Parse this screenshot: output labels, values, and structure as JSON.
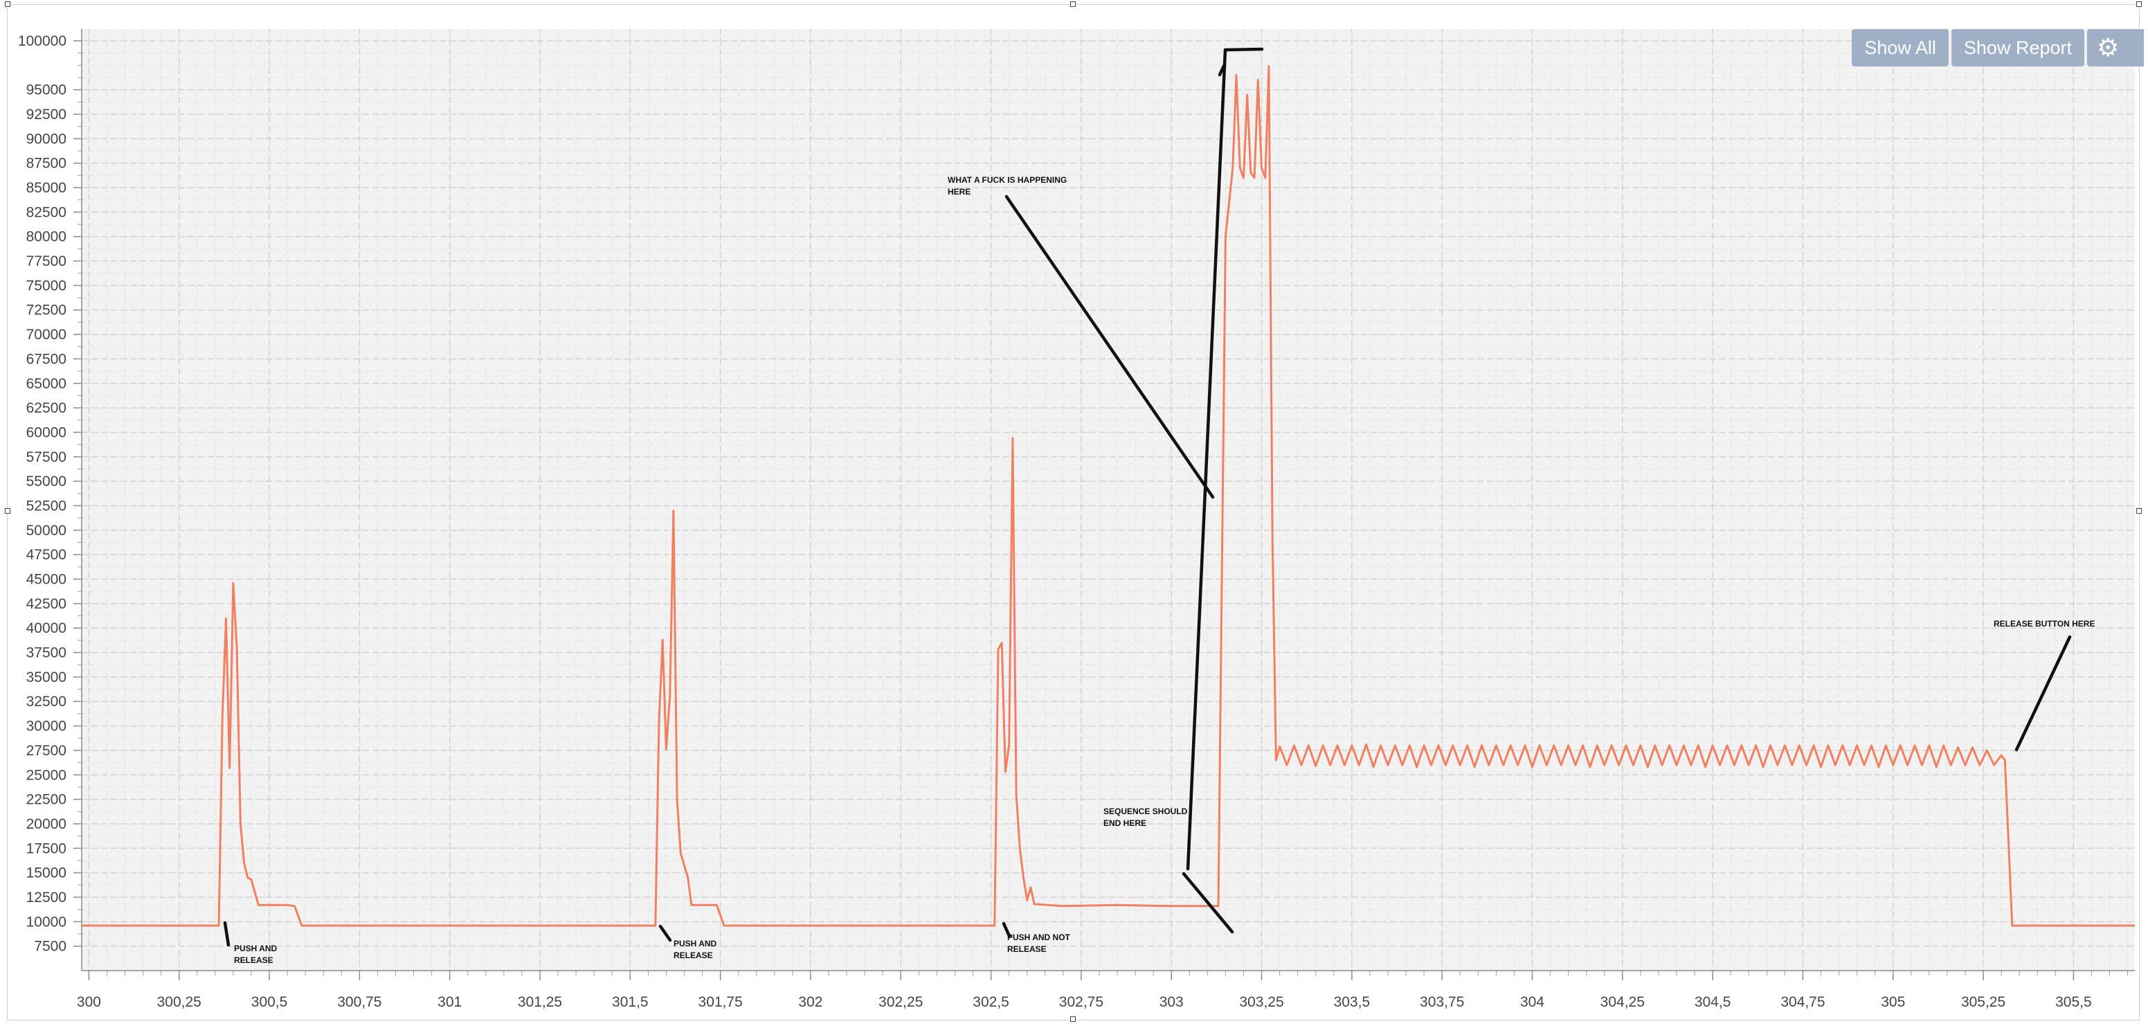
{
  "toolbar": {
    "show_all_label": "Show All",
    "show_report_label": "Show Report",
    "settings_icon": "gear-icon"
  },
  "chart_data": {
    "type": "line",
    "title": "",
    "xlabel": "",
    "ylabel": "",
    "xlim": [
      299.98,
      305.67
    ],
    "ylim": [
      5000,
      101200
    ],
    "grid": true,
    "line_color": "#f08060",
    "x_ticks": [
      "300",
      "300,25",
      "300,5",
      "300,75",
      "301",
      "301,25",
      "301,5",
      "301,75",
      "302",
      "302,25",
      "302,5",
      "302,75",
      "303",
      "303,25",
      "303,5",
      "303,75",
      "304",
      "304,25",
      "304,5",
      "304,75",
      "305",
      "305,25",
      "305,5"
    ],
    "y_ticks": [
      "100000",
      "95000",
      "92500",
      "90000",
      "87500",
      "85000",
      "82500",
      "80000",
      "77500",
      "75000",
      "72500",
      "70000",
      "67500",
      "65000",
      "62500",
      "60000",
      "57500",
      "55000",
      "52500",
      "50000",
      "47500",
      "45000",
      "42500",
      "40000",
      "37500",
      "35000",
      "32500",
      "30000",
      "27500",
      "25000",
      "22500",
      "20000",
      "17500",
      "15000",
      "12500",
      "10000",
      "7500"
    ],
    "series": [
      {
        "points": [
          [
            299.98,
            9600
          ],
          [
            300.36,
            9600
          ],
          [
            300.37,
            31000
          ],
          [
            300.38,
            41000
          ],
          [
            300.39,
            25700
          ],
          [
            300.4,
            44600
          ],
          [
            300.41,
            38000
          ],
          [
            300.42,
            20000
          ],
          [
            300.43,
            16000
          ],
          [
            300.44,
            14500
          ],
          [
            300.45,
            14300
          ],
          [
            300.47,
            11700
          ],
          [
            300.55,
            11700
          ],
          [
            300.57,
            11600
          ],
          [
            300.59,
            9600
          ],
          [
            301.57,
            9600
          ],
          [
            301.58,
            30500
          ],
          [
            301.59,
            38800
          ],
          [
            301.6,
            27600
          ],
          [
            301.61,
            33000
          ],
          [
            301.62,
            52000
          ],
          [
            301.63,
            22500
          ],
          [
            301.64,
            17000
          ],
          [
            301.66,
            14500
          ],
          [
            301.67,
            11700
          ],
          [
            301.74,
            11700
          ],
          [
            301.76,
            9600
          ],
          [
            302.51,
            9600
          ],
          [
            302.52,
            37800
          ],
          [
            302.53,
            38500
          ],
          [
            302.54,
            25300
          ],
          [
            302.55,
            28000
          ],
          [
            302.56,
            59400
          ],
          [
            302.57,
            23000
          ],
          [
            302.58,
            17500
          ],
          [
            302.59,
            14500
          ],
          [
            302.6,
            12200
          ],
          [
            302.61,
            13500
          ],
          [
            302.62,
            11800
          ],
          [
            302.7,
            11600
          ],
          [
            302.85,
            11700
          ],
          [
            303.0,
            11600
          ],
          [
            303.13,
            11600
          ],
          [
            303.15,
            80000
          ],
          [
            303.17,
            87000
          ],
          [
            303.18,
            96500
          ],
          [
            303.19,
            87000
          ],
          [
            303.2,
            86000
          ],
          [
            303.21,
            94500
          ],
          [
            303.22,
            86500
          ],
          [
            303.23,
            86000
          ],
          [
            303.24,
            96000
          ],
          [
            303.25,
            87000
          ],
          [
            303.26,
            86000
          ],
          [
            303.27,
            97400
          ],
          [
            303.28,
            49000
          ],
          [
            303.29,
            26500
          ],
          [
            303.3,
            27900
          ],
          [
            303.32,
            26000
          ],
          [
            303.34,
            28000
          ],
          [
            303.36,
            26000
          ],
          [
            303.38,
            28000
          ],
          [
            303.4,
            25900
          ],
          [
            303.42,
            28000
          ],
          [
            303.44,
            26000
          ],
          [
            303.46,
            28000
          ],
          [
            303.48,
            26000
          ],
          [
            303.5,
            28000
          ],
          [
            303.52,
            26000
          ],
          [
            303.54,
            28100
          ],
          [
            303.56,
            25800
          ],
          [
            303.58,
            28000
          ],
          [
            303.6,
            26000
          ],
          [
            303.62,
            28000
          ],
          [
            303.64,
            26000
          ],
          [
            303.66,
            28000
          ],
          [
            303.68,
            25800
          ],
          [
            303.7,
            28000
          ],
          [
            303.72,
            26000
          ],
          [
            303.74,
            28000
          ],
          [
            303.76,
            26000
          ],
          [
            303.78,
            28000
          ],
          [
            303.8,
            26000
          ],
          [
            303.82,
            28000
          ],
          [
            303.84,
            25800
          ],
          [
            303.86,
            28000
          ],
          [
            303.88,
            26000
          ],
          [
            303.9,
            28000
          ],
          [
            303.92,
            26000
          ],
          [
            303.94,
            28000
          ],
          [
            303.96,
            26000
          ],
          [
            303.98,
            28000
          ],
          [
            304.0,
            25800
          ],
          [
            304.02,
            28000
          ],
          [
            304.04,
            26000
          ],
          [
            304.06,
            28000
          ],
          [
            304.08,
            26000
          ],
          [
            304.1,
            28000
          ],
          [
            304.12,
            26000
          ],
          [
            304.14,
            28000
          ],
          [
            304.16,
            25800
          ],
          [
            304.18,
            28000
          ],
          [
            304.2,
            26000
          ],
          [
            304.22,
            28000
          ],
          [
            304.24,
            26000
          ],
          [
            304.26,
            28000
          ],
          [
            304.28,
            26000
          ],
          [
            304.3,
            28000
          ],
          [
            304.32,
            25800
          ],
          [
            304.34,
            28000
          ],
          [
            304.36,
            26000
          ],
          [
            304.38,
            28000
          ],
          [
            304.4,
            26000
          ],
          [
            304.42,
            28000
          ],
          [
            304.44,
            26000
          ],
          [
            304.46,
            28000
          ],
          [
            304.48,
            25800
          ],
          [
            304.5,
            28000
          ],
          [
            304.52,
            26000
          ],
          [
            304.54,
            28000
          ],
          [
            304.56,
            26000
          ],
          [
            304.58,
            28000
          ],
          [
            304.6,
            26000
          ],
          [
            304.62,
            28000
          ],
          [
            304.64,
            25800
          ],
          [
            304.66,
            28000
          ],
          [
            304.68,
            26000
          ],
          [
            304.7,
            28000
          ],
          [
            304.72,
            26000
          ],
          [
            304.74,
            28000
          ],
          [
            304.76,
            26000
          ],
          [
            304.78,
            28000
          ],
          [
            304.8,
            25800
          ],
          [
            304.82,
            28000
          ],
          [
            304.84,
            26000
          ],
          [
            304.86,
            28000
          ],
          [
            304.88,
            26000
          ],
          [
            304.9,
            28000
          ],
          [
            304.92,
            26000
          ],
          [
            304.94,
            28000
          ],
          [
            304.96,
            25800
          ],
          [
            304.98,
            28000
          ],
          [
            305.0,
            26000
          ],
          [
            305.02,
            28000
          ],
          [
            305.04,
            26000
          ],
          [
            305.06,
            28000
          ],
          [
            305.08,
            26000
          ],
          [
            305.1,
            28000
          ],
          [
            305.12,
            25800
          ],
          [
            305.14,
            28000
          ],
          [
            305.16,
            26000
          ],
          [
            305.18,
            27800
          ],
          [
            305.2,
            26000
          ],
          [
            305.22,
            27800
          ],
          [
            305.24,
            26000
          ],
          [
            305.26,
            27500
          ],
          [
            305.28,
            26000
          ],
          [
            305.3,
            27000
          ],
          [
            305.31,
            26500
          ],
          [
            305.33,
            9600
          ],
          [
            305.67,
            9600
          ]
        ]
      }
    ],
    "annotations": [
      {
        "lines": [
          "PUSH AND",
          "RELEASE"
        ]
      },
      {
        "lines": [
          "PUSH AND",
          "RELEASE"
        ]
      },
      {
        "lines": [
          "PUSH AND NOT",
          "RELEASE"
        ]
      },
      {
        "lines": [
          "WHAT A FUCK IS HAPPENING",
          "HERE"
        ]
      },
      {
        "lines": [
          "SEQUENCE SHOULD",
          "END HERE"
        ]
      },
      {
        "lines": [
          "RELEASE BUTTON HERE"
        ]
      }
    ]
  }
}
